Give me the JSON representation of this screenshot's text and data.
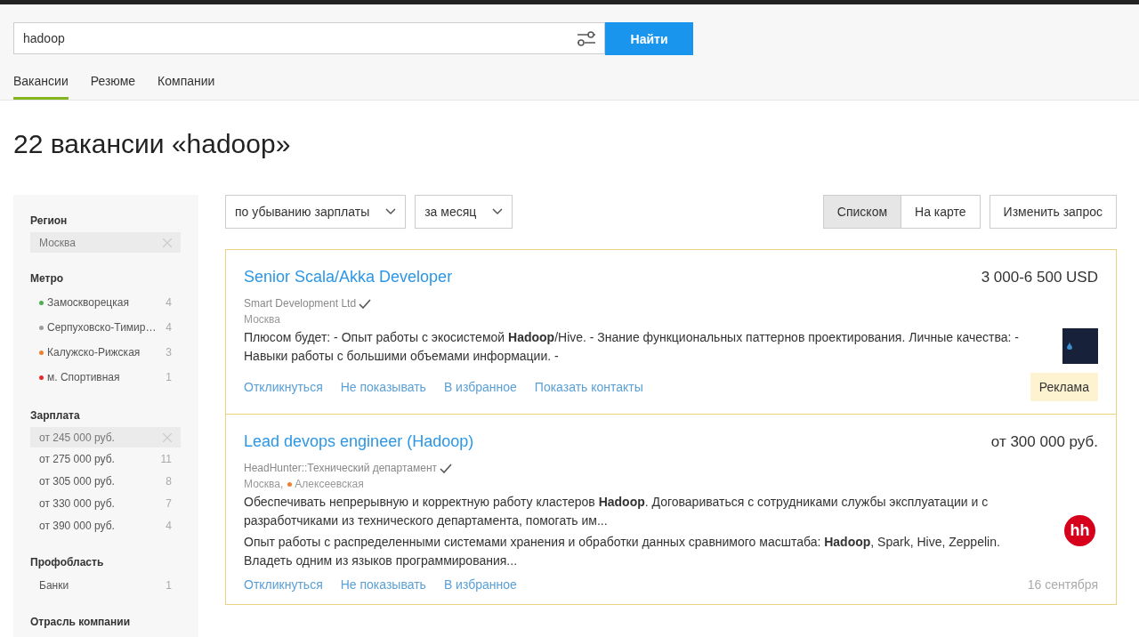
{
  "search": {
    "value": "hadoop",
    "button": "Найти"
  },
  "tabs": [
    {
      "label": "Вакансии",
      "selected": true
    },
    {
      "label": "Резюме",
      "selected": false
    },
    {
      "label": "Компании",
      "selected": false
    }
  ],
  "heading": "22 вакансии «hadoop»",
  "sidebar": {
    "sections": [
      {
        "title": "Регион",
        "items": [
          {
            "label": "Москва",
            "selected": true
          }
        ]
      },
      {
        "title": "Метро",
        "items": [
          {
            "label": "Замоскворецкая",
            "count": "4",
            "color": "#4caf50",
            "selected": false
          },
          {
            "label": "Серпуховско-Тимир…",
            "count": "4",
            "color": "#9e9e9e",
            "selected": false
          },
          {
            "label": "Калужско-Рижская",
            "count": "3",
            "color": "#f0802f",
            "selected": false
          },
          {
            "label": "м. Спортивная",
            "count": "1",
            "color": "#e52b2b",
            "selected": false
          }
        ]
      },
      {
        "title": "Зарплата",
        "items": [
          {
            "label": "от 245 000 руб.",
            "selected": true
          },
          {
            "label": "от 275 000 руб.",
            "count": "11",
            "selected": false
          },
          {
            "label": "от 305 000 руб.",
            "count": "8",
            "selected": false
          },
          {
            "label": "от 330 000 руб.",
            "count": "7",
            "selected": false
          },
          {
            "label": "от 390 000 руб.",
            "count": "4",
            "selected": false
          }
        ]
      },
      {
        "title": "Профобласть",
        "items": [
          {
            "label": "Банки",
            "count": "1",
            "selected": false
          }
        ]
      },
      {
        "title": "Отрасль компании"
      }
    ]
  },
  "toolbar": {
    "dropdowns": [
      "по убыванию зарплаты",
      "за месяц"
    ],
    "views": [
      {
        "label": "Списком",
        "selected": true
      },
      {
        "label": "На карте",
        "selected": false
      }
    ],
    "button": "Изменить запрос"
  },
  "vacancies": [
    {
      "title": "Senior Scala/Akka Developer",
      "salary": "3 000-6 500 USD",
      "company": "Smart Development Ltd",
      "verified": true,
      "location": "Москва",
      "snippets": [
        "Плюсом будет: - Опыт работы с экосистемой **Hadoop**/Hive. - Знание функциональных паттернов проектирования. Личные качества: - Навыки работы с большими объемами информации. -"
      ],
      "actions": [
        "Откликнуться",
        "Не показывать",
        "В избранное",
        "Показать контакты"
      ],
      "logo": {
        "kind": "dark-square"
      },
      "footer": {
        "kind": "ad",
        "text": "Реклама"
      }
    },
    {
      "title": "Lead devops engineer (Hadoop)",
      "salary": "от 300 000 руб.",
      "company": "HeadHunter::Технический департамент",
      "verified": true,
      "location": "Москва,",
      "station": {
        "name": "Алексеевская",
        "color": "#f0802f"
      },
      "snippets": [
        "Обеспечивать непрерывную и корректную работу кластеров **Hadoop**. Договариваться с сотрудниками службы эксплуатации и с разработчиками из технического департамента, помогать им...",
        "Опыт работы с распределенными системами хранения и обработки данных сравнимого масштаба: **Hadoop**, Spark, Hive, Zeppelin. Владеть одним из языков программирования..."
      ],
      "actions": [
        "Откликнуться",
        "Не показывать",
        "В избранное"
      ],
      "logo": {
        "kind": "round",
        "text": "hh"
      },
      "footer": {
        "kind": "date",
        "text": "16 сентября"
      }
    }
  ]
}
